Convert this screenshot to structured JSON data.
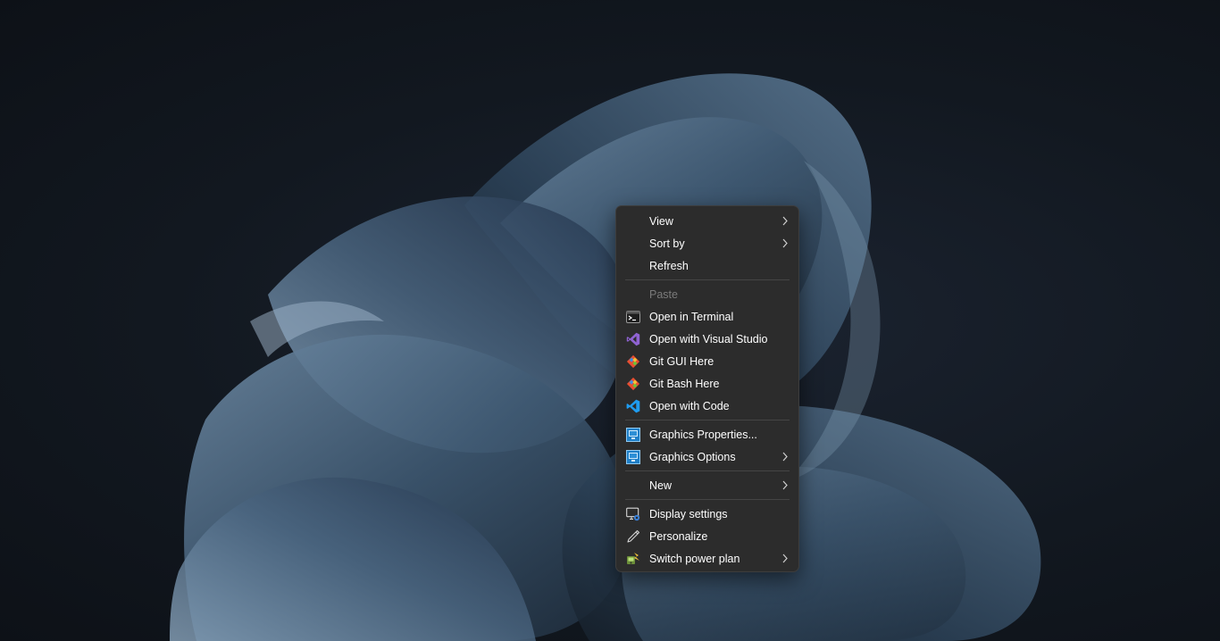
{
  "menu": {
    "view": "View",
    "sort_by": "Sort by",
    "refresh": "Refresh",
    "paste": "Paste",
    "open_terminal": "Open in Terminal",
    "open_visual_studio": "Open with Visual Studio",
    "git_gui": "Git GUI Here",
    "git_bash": "Git Bash Here",
    "open_code": "Open with Code",
    "graphics_properties": "Graphics Properties...",
    "graphics_options": "Graphics Options",
    "new": "New",
    "display_settings": "Display settings",
    "personalize": "Personalize",
    "switch_power_plan": "Switch power plan"
  },
  "icons": {
    "terminal": "terminal-icon",
    "visual_studio": "visual-studio-icon",
    "git": "git-icon",
    "vscode": "vscode-icon",
    "graphics": "intel-graphics-icon",
    "display": "display-settings-icon",
    "personalize": "pen-icon",
    "power": "power-plan-icon",
    "submenu": "chevron-right-icon"
  },
  "colors": {
    "menu_bg": "#2c2c2c",
    "separator": "#454545",
    "text": "#ffffff",
    "disabled_text": "#7a7a7a",
    "wallpaper_accent": "#4a6680"
  }
}
